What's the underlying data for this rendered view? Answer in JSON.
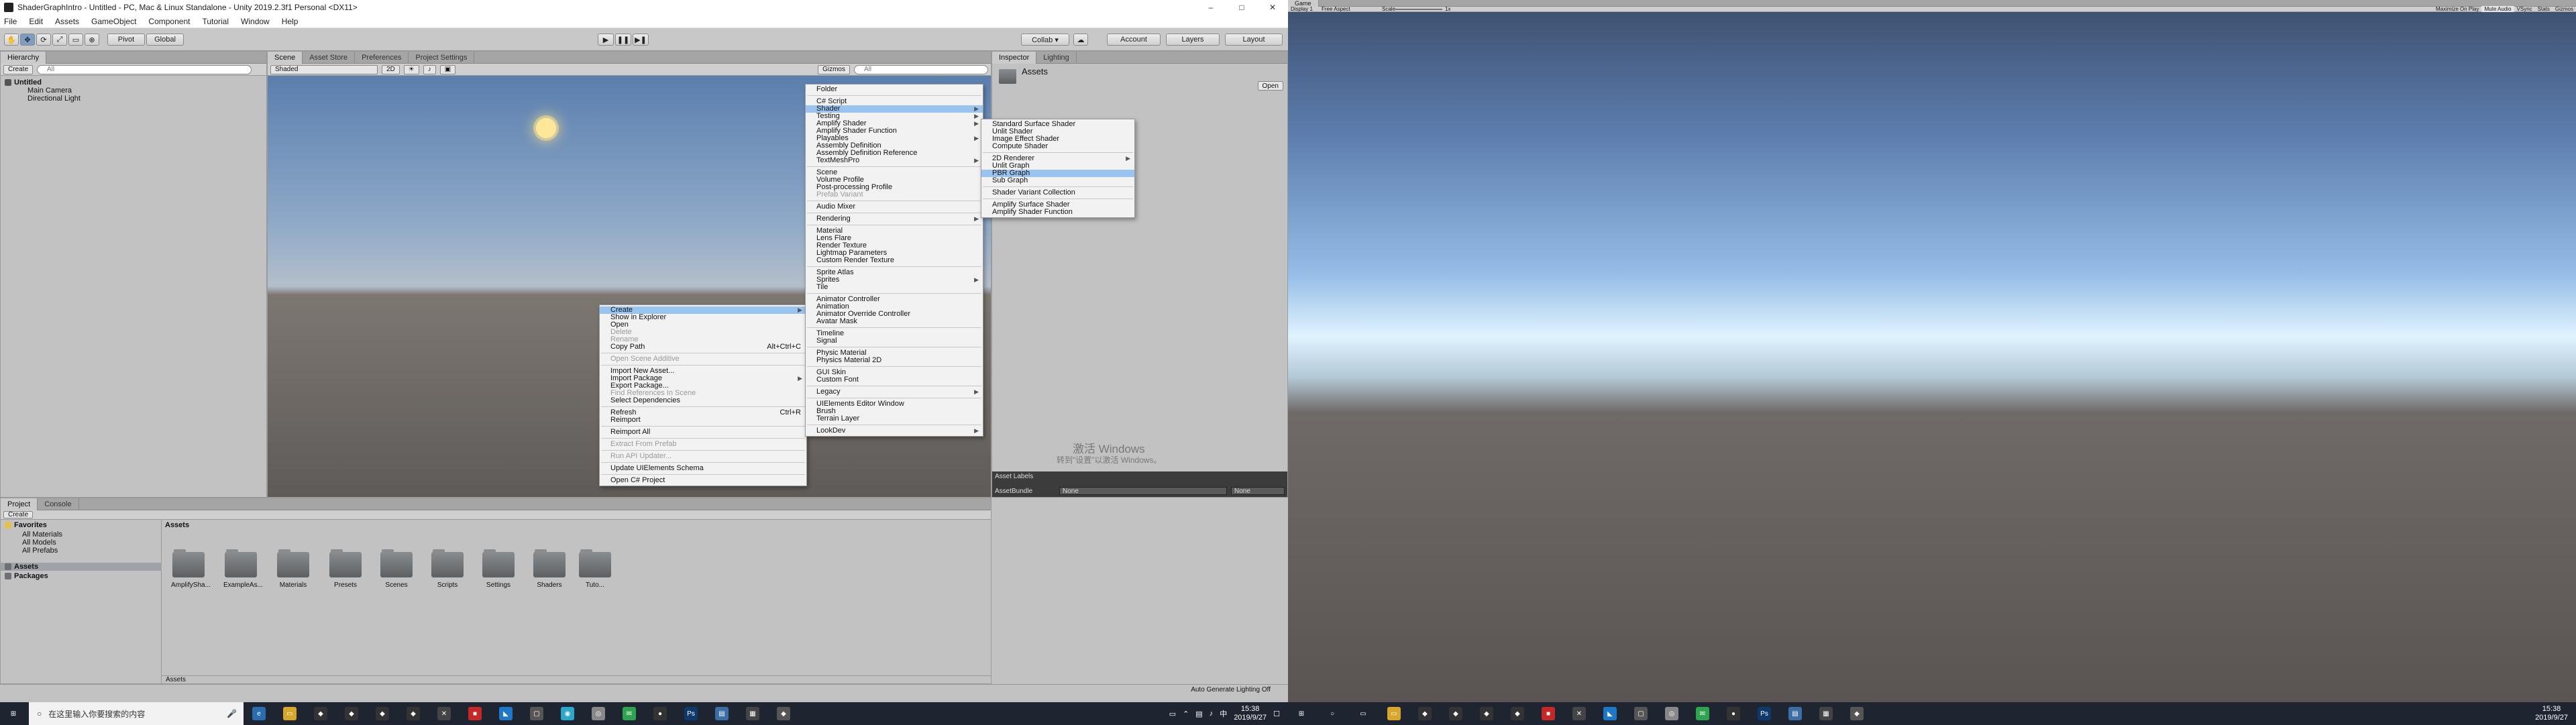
{
  "window": {
    "title": "ShaderGraphIntro - Untitled - PC, Mac & Linux Standalone - Unity 2019.2.3f1 Personal <DX11>",
    "controls": [
      "–",
      "□",
      "✕"
    ]
  },
  "menubar": [
    "File",
    "Edit",
    "Assets",
    "GameObject",
    "Component",
    "Tutorial",
    "Window",
    "Help"
  ],
  "toolbar": {
    "pivot": "Pivot",
    "global": "Global",
    "collab": "Collab ▾",
    "account": "Account",
    "layers": "Layers",
    "layout": "Layout"
  },
  "hierarchy": {
    "tab": "Hierarchy",
    "create": "Create",
    "search_placeholder": "All",
    "scene": "Untitled",
    "items": [
      "Main Camera",
      "Directional Light"
    ]
  },
  "scene_view": {
    "tabs": [
      "Scene",
      "Asset Store",
      "Preferences",
      "Project Settings"
    ],
    "shaded": "Shaded",
    "mode_2d": "2D",
    "gizmos": "Gizmos",
    "search_placeholder": "All"
  },
  "inspector": {
    "tabs": [
      "Inspector",
      "Lighting"
    ],
    "title": "Assets",
    "open": "Open",
    "asset_labels": "Asset Labels",
    "asset_bundle": "AssetBundle",
    "none1": "None",
    "none2": "None"
  },
  "project": {
    "tabs": [
      "Project",
      "Console"
    ],
    "create": "Create",
    "favorites": "Favorites",
    "fav_items": [
      "All Materials",
      "All Models",
      "All Prefabs"
    ],
    "assets_root": "Assets",
    "packages": "Packages",
    "breadcrumb": "Assets",
    "folders": [
      "AmplifySha...",
      "ExampleAs...",
      "Materials",
      "Presets",
      "Scenes",
      "Scripts",
      "Settings",
      "Shaders",
      "Tuto..."
    ],
    "footer": "Assets"
  },
  "context_menu": {
    "items": [
      {
        "label": "Create",
        "arrow": true,
        "hl": true
      },
      {
        "label": "Show in Explorer"
      },
      {
        "label": "Open"
      },
      {
        "label": "Delete",
        "dis": true
      },
      {
        "label": "Rename",
        "dis": true
      },
      {
        "label": "Copy Path",
        "shortcut": "Alt+Ctrl+C"
      },
      {
        "sep": true
      },
      {
        "label": "Open Scene Additive",
        "dis": true
      },
      {
        "sep": true
      },
      {
        "label": "Import New Asset..."
      },
      {
        "label": "Import Package",
        "arrow": true
      },
      {
        "label": "Export Package..."
      },
      {
        "label": "Find References In Scene",
        "dis": true
      },
      {
        "label": "Select Dependencies"
      },
      {
        "sep": true
      },
      {
        "label": "Refresh",
        "shortcut": "Ctrl+R"
      },
      {
        "label": "Reimport"
      },
      {
        "sep": true
      },
      {
        "label": "Reimport All"
      },
      {
        "sep": true
      },
      {
        "label": "Extract From Prefab",
        "dis": true
      },
      {
        "sep": true
      },
      {
        "label": "Run API Updater...",
        "dis": true
      },
      {
        "sep": true
      },
      {
        "label": "Update UIElements Schema"
      },
      {
        "sep": true
      },
      {
        "label": "Open C# Project"
      }
    ]
  },
  "create_menu": {
    "items": [
      {
        "label": "Folder"
      },
      {
        "sep": true
      },
      {
        "label": "C# Script"
      },
      {
        "label": "Shader",
        "arrow": true,
        "hl": true
      },
      {
        "label": "Testing",
        "arrow": true
      },
      {
        "label": "Amplify Shader",
        "arrow": true
      },
      {
        "label": "Amplify Shader Function"
      },
      {
        "label": "Playables",
        "arrow": true
      },
      {
        "label": "Assembly Definition"
      },
      {
        "label": "Assembly Definition Reference"
      },
      {
        "label": "TextMeshPro",
        "arrow": true
      },
      {
        "sep": true
      },
      {
        "label": "Scene"
      },
      {
        "label": "Volume Profile"
      },
      {
        "label": "Post-processing Profile"
      },
      {
        "label": "Prefab Variant",
        "dis": true
      },
      {
        "sep": true
      },
      {
        "label": "Audio Mixer"
      },
      {
        "sep": true
      },
      {
        "label": "Rendering",
        "arrow": true
      },
      {
        "sep": true
      },
      {
        "label": "Material"
      },
      {
        "label": "Lens Flare"
      },
      {
        "label": "Render Texture"
      },
      {
        "label": "Lightmap Parameters"
      },
      {
        "label": "Custom Render Texture"
      },
      {
        "sep": true
      },
      {
        "label": "Sprite Atlas"
      },
      {
        "label": "Sprites",
        "arrow": true
      },
      {
        "label": "Tile"
      },
      {
        "sep": true
      },
      {
        "label": "Animator Controller"
      },
      {
        "label": "Animation"
      },
      {
        "label": "Animator Override Controller"
      },
      {
        "label": "Avatar Mask"
      },
      {
        "sep": true
      },
      {
        "label": "Timeline"
      },
      {
        "label": "Signal"
      },
      {
        "sep": true
      },
      {
        "label": "Physic Material"
      },
      {
        "label": "Physics Material 2D"
      },
      {
        "sep": true
      },
      {
        "label": "GUI Skin"
      },
      {
        "label": "Custom Font"
      },
      {
        "sep": true
      },
      {
        "label": "Legacy",
        "arrow": true
      },
      {
        "sep": true
      },
      {
        "label": "UIElements Editor Window"
      },
      {
        "label": "Brush"
      },
      {
        "label": "Terrain Layer"
      },
      {
        "sep": true
      },
      {
        "label": "LookDev",
        "arrow": true
      }
    ]
  },
  "shader_menu": {
    "items": [
      {
        "label": "Standard Surface Shader"
      },
      {
        "label": "Unlit Shader"
      },
      {
        "label": "Image Effect Shader"
      },
      {
        "label": "Compute Shader"
      },
      {
        "sep": true
      },
      {
        "label": "2D Renderer",
        "arrow": true
      },
      {
        "label": "Unlit Graph"
      },
      {
        "label": "PBR Graph",
        "hl": true
      },
      {
        "label": "Sub Graph"
      },
      {
        "sep": true
      },
      {
        "label": "Shader Variant Collection"
      },
      {
        "sep": true
      },
      {
        "label": "Amplify Surface Shader"
      },
      {
        "label": "Amplify Shader Function"
      }
    ]
  },
  "watermark": {
    "line1": "激活 Windows",
    "line2": "转到\"设置\"以激活 Windows。"
  },
  "status_bar": {
    "lighting": "Auto Generate Lighting Off"
  },
  "game_view": {
    "tab": "Game",
    "display": "Display 1",
    "aspect": "Free Aspect",
    "scale_label": "Scale",
    "scale_value": "1x",
    "buttons": [
      "Maximize On Play",
      "Mute Audio",
      "VSync",
      "Stats",
      "Gizmos"
    ]
  },
  "taskbar_left": {
    "search_placeholder": "在这里输入你要搜索的内容",
    "time": "15:38",
    "date": "2019/9/27",
    "ime": "中"
  },
  "taskbar_right": {
    "time": "15:38",
    "date": "2019/9/27"
  },
  "colors": {
    "highlight": "#99c4ef",
    "panel": "#c2c2c2",
    "taskbar": "#1e2531"
  }
}
